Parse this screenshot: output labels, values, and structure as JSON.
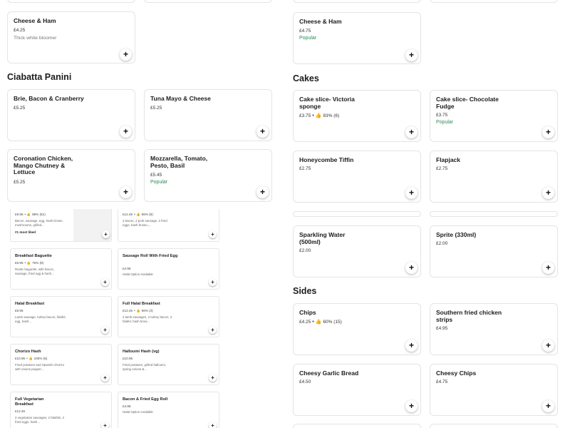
{
  "left": {
    "top_card": {
      "name": "Cheese & Ham",
      "price": "£4.25",
      "desc": "Thick white bloomer"
    },
    "section": "Ciabatta Panini",
    "cards": [
      {
        "name": "Brie, Bacon & Cranberry",
        "price": "£5.25"
      },
      {
        "name": "Tuna Mayo & Cheese",
        "price": "£5.25"
      },
      {
        "name": "Coronation Chicken, Mango Chutney & Lettuce",
        "price": "£5.25"
      },
      {
        "name": "Mozzarella, Tomato, Pesto, Basil",
        "price": "£5.45",
        "tag": "Popular"
      }
    ]
  },
  "embedded": {
    "top_left": {
      "price": "£9.95",
      "rating": "88% (51)",
      "desc": "Bacon, sausage, egg, hash brown, mushrooms, grilled...",
      "badge": "#1 most liked"
    },
    "top_right": {
      "price": "£12.45",
      "rating": "66% (8)",
      "desc": "2 bacon, 2 pork sausage, 2 fried eggs, hash brown,..."
    },
    "items": [
      {
        "name": "Breakfast Baguette",
        "price": "£6.95",
        "rating": "75% (8)",
        "desc": "Rustic baguette, with bacon, sausage, fried egg & hash..."
      },
      {
        "name": "Sausage Roll With Fried Egg",
        "price": "£4.95",
        "desc": "Halal Option Available"
      },
      {
        "name": "Halal Breakfast",
        "price": "£9.95",
        "desc": "Lamb sausage, turkey bacon, falafel, egg, hash..."
      },
      {
        "name": "Full Halal Breakfast",
        "price": "£12.45",
        "rating": "66% (3)",
        "desc": "2 lamb sausages, 2 turkey bacon, 2 falafel, hash brow..."
      },
      {
        "name": "Chorizo Hash",
        "price": "£10.95",
        "rating": "100% (5)",
        "desc": "Fried potatoes and Spanish chorizo with onions pepper..."
      },
      {
        "name": "Halloumi Hash (vg)",
        "price": "£10.95",
        "desc": "Fried potatoes, grilled halloumi, spring onions &..."
      },
      {
        "name": "Full Vegetarian Breakfast",
        "price": "£12.45",
        "desc": "2 vegetarian sausages, 2 falafels, 2 fried eggs, hash..."
      },
      {
        "name": "Bacon & Fried Egg Roll",
        "price": "£4.95",
        "desc": "Halal Option Available"
      }
    ]
  },
  "right": {
    "top_card": {
      "name": "Cheese & Ham",
      "price": "£4.75",
      "tag": "Popular"
    },
    "cakes_section": "Cakes",
    "cakes": [
      {
        "name": "Cake slice- Victoria sponge",
        "price": "£3.75",
        "rating": "83% (6)"
      },
      {
        "name": "Cake slice- Chocolate Fudge",
        "price": "£3.75",
        "tag": "Popular"
      },
      {
        "name": "Honeycombe Tiffin",
        "price": "£2.75"
      },
      {
        "name": "Flapjack",
        "price": "£2.75"
      }
    ],
    "drinks": [
      {
        "name": "Sparkling Water (500ml)",
        "price": "£2.00"
      },
      {
        "name": "Sprite (330ml)",
        "price": "£2.00"
      }
    ],
    "sides_section": "Sides",
    "sides": [
      {
        "name": "Chips",
        "price": "£4.25",
        "rating": "60% (15)"
      },
      {
        "name": "Southern fried chicken strips",
        "price": "£4.95"
      },
      {
        "name": "Cheesy Garlic Bread",
        "price": "£4.50"
      },
      {
        "name": "Cheesy Chips",
        "price": "£4.75"
      }
    ]
  },
  "add_symbol": "+",
  "rating_icon": "thumbs-up-icon",
  "accent_popular": "#2e8b57"
}
